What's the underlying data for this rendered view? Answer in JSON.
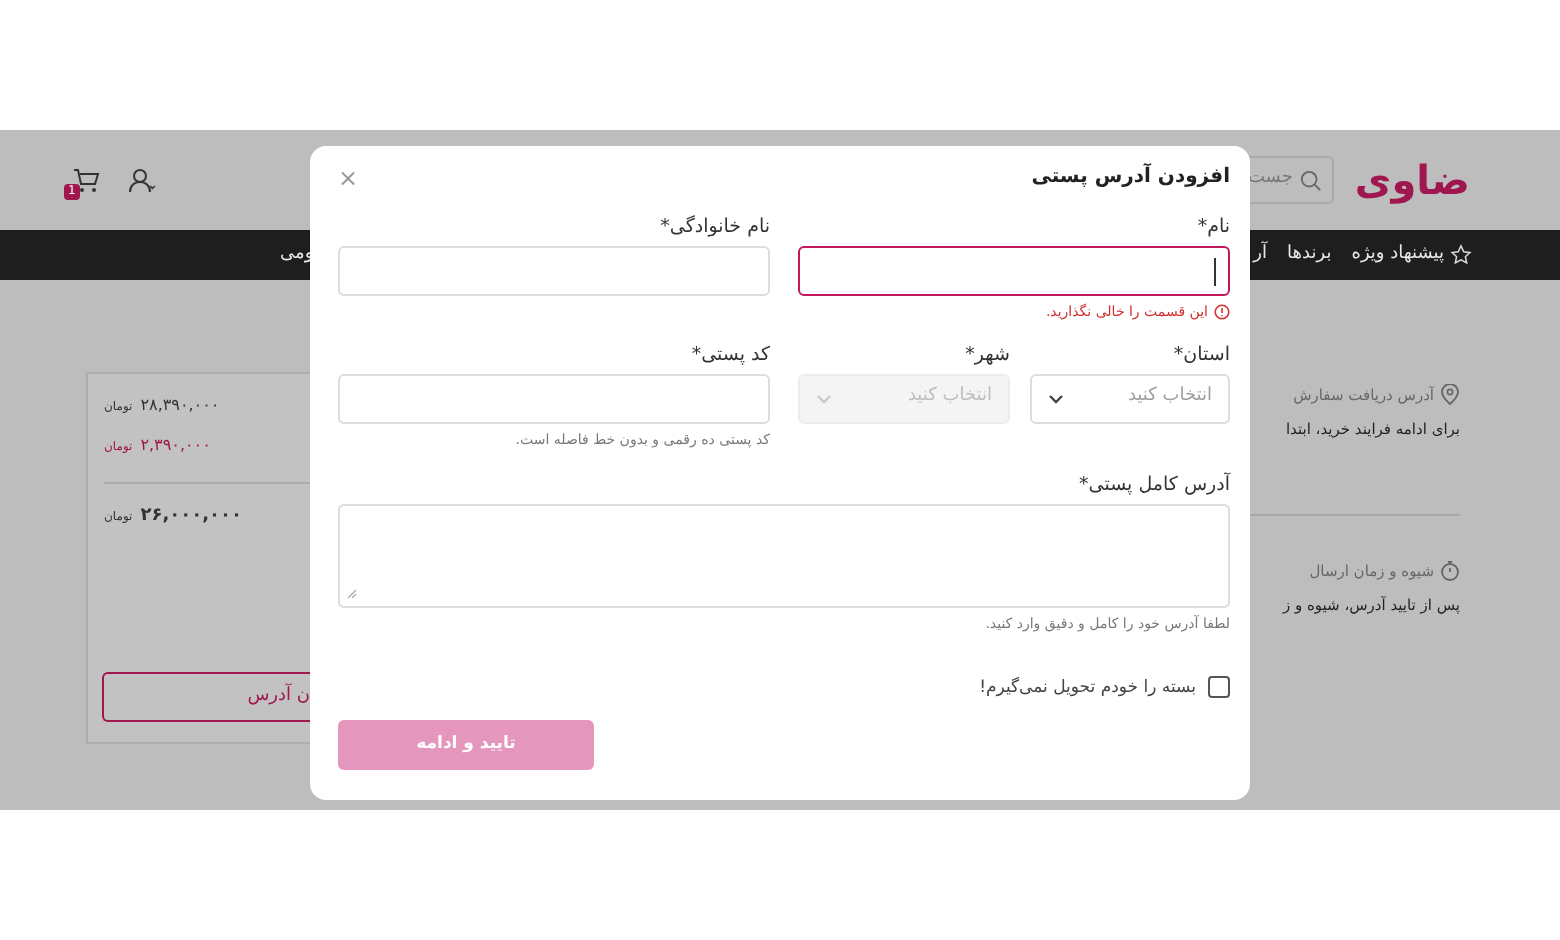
{
  "header": {
    "logo": "ضاوی",
    "search": {
      "placeholder": "جست"
    },
    "cart_badge": "1"
  },
  "nav": {
    "items": [
      {
        "label": "پیشنهاد ویژه",
        "kind": "special"
      },
      {
        "label": "برندها",
        "kind": "plain"
      },
      {
        "label": "آر",
        "kind": "plain"
      }
    ],
    "left_item": "ومی"
  },
  "summary": {
    "prices": [
      {
        "amount": "۲۸,۳۹۰,۰۰۰",
        "currency": "تومان",
        "kind": "normal"
      },
      {
        "amount": "۲,۳۹۰,۰۰۰",
        "currency": "تومان",
        "kind": "discount"
      },
      {
        "amount": "۲۶,۰۰۰,۰۰۰",
        "currency": "تومان",
        "kind": "total"
      }
    ],
    "button": "ن آدرس"
  },
  "steps": [
    {
      "title": "آدرس دریافت سفارش",
      "text": "برای ادامه فرایند خرید، ابتدا",
      "kind": "pin"
    },
    {
      "title": "شیوه و زمان ارسال",
      "text": "پس از تایید آدرس، شیوه و ز",
      "kind": "clock"
    }
  ],
  "dialog": {
    "title": "افزودن آدرس پستی",
    "close": "×",
    "fields": [
      {
        "label": "نام*",
        "kind": "input",
        "error": true,
        "focused": true,
        "error_message": "این قسمت را خالی نگذارید."
      },
      {
        "label": "نام خانوادگی*",
        "kind": "input",
        "error": false,
        "focused": false
      },
      {
        "label": "استان*",
        "kind": "select",
        "placeholder": "انتخاب کنید",
        "disabled": false
      },
      {
        "label": "شهر*",
        "kind": "select",
        "placeholder": "انتخاب کنید",
        "disabled": true
      },
      {
        "label": "کد پستی*",
        "kind": "input",
        "error": false,
        "focused": false,
        "hint": "کد پستی ده رقمی و بدون خط فاصله است."
      },
      {
        "label": "آدرس کامل پستی*",
        "kind": "textarea",
        "hint": "لطفا آدرس خود را کامل و دقیق وارد کنید."
      }
    ],
    "checkbox": {
      "label": "بسته را خودم تحویل نمی‌گیرم!",
      "checked": false
    },
    "submit": {
      "label": "تایید و ادامه",
      "disabled": true
    }
  }
}
